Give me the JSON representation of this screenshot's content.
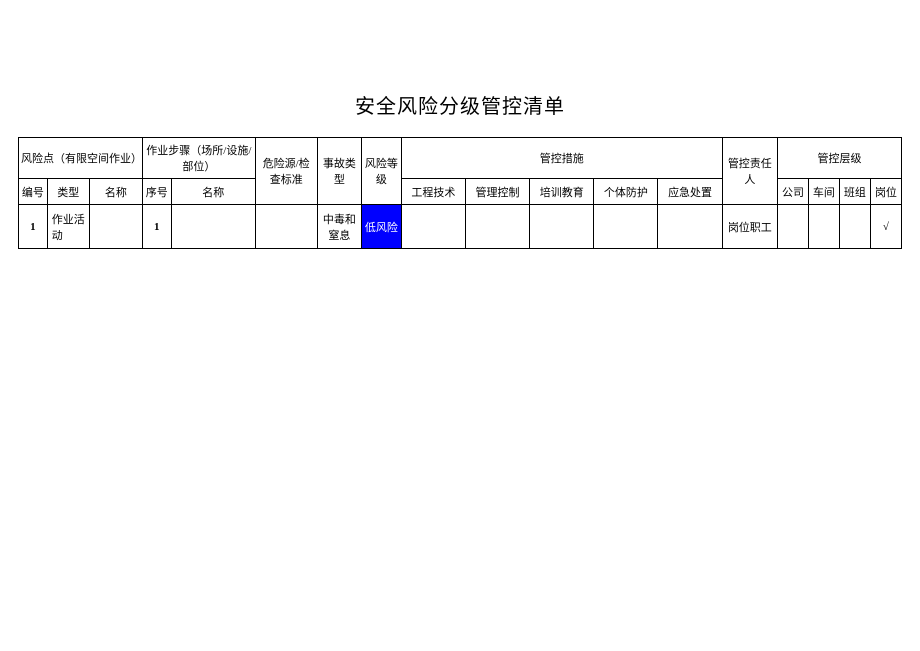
{
  "title": "安全风险分级管控清单",
  "header": {
    "riskPoint": "风险点（有限空间作业）",
    "workStep": "作业步骤（场所/设施/部位）",
    "hazard": "危险源/检查标准",
    "accidentType": "事故类型",
    "riskLevel": "风险等级",
    "controlMeasures": "管控措施",
    "responsible": "管控责任人",
    "controlLevel": "管控层级",
    "sub": {
      "number": "编号",
      "type": "类型",
      "name": "名称",
      "seq": "序号",
      "stepName": "名称",
      "engTech": "工程技术",
      "mgmtCtrl": "管理控制",
      "training": "培训教育",
      "ppe": "个体防护",
      "emergency": "应急处置",
      "company": "公司",
      "workshop": "车间",
      "team": "班组",
      "post": "岗位"
    }
  },
  "rows": [
    {
      "number": "1",
      "type": "作业活动",
      "name": "",
      "seq": "1",
      "stepName": "",
      "hazard": "",
      "accidentType": "中毒和窒息",
      "riskLevel": "低风险",
      "engTech": "",
      "mgmtCtrl": "",
      "training": "",
      "ppe": "",
      "emergency": "",
      "responsible": "岗位职工",
      "company": "",
      "workshop": "",
      "team": "",
      "post": "√"
    }
  ]
}
